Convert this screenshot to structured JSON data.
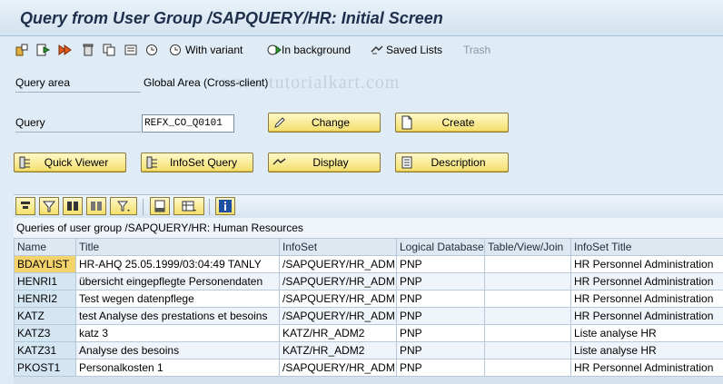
{
  "window": {
    "title": "Query from User Group /SAPQUERY/HR: Initial Screen"
  },
  "toolbar": {
    "with_variant": "With variant",
    "in_background": "In background",
    "saved_lists": "Saved Lists",
    "trash": "Trash",
    "watermark": "www.tutorialkart.com"
  },
  "form": {
    "query_area_label": "Query area",
    "query_area_value": "Global Area (Cross-client)",
    "query_label": "Query",
    "query_value": "REFX_CO_Q0101",
    "change": "Change",
    "create": "Create",
    "quick_viewer": "Quick Viewer",
    "infoset_query": "InfoSet Query",
    "display": "Display",
    "description": "Description"
  },
  "grid": {
    "caption": "Queries of user group /SAPQUERY/HR: Human Resources",
    "columns": [
      "Name",
      "Title",
      "InfoSet",
      "Logical Database",
      "Table/View/Join",
      "InfoSet Title"
    ],
    "rows": [
      [
        "BDAYLIST",
        "HR-AHQ 25.05.1999/03:04:49 TANLY",
        "/SAPQUERY/HR_ADM",
        "PNP",
        "",
        "HR Personnel Administration"
      ],
      [
        "HENRI1",
        "übersicht eingepflegte Personendaten",
        "/SAPQUERY/HR_ADM",
        "PNP",
        "",
        "HR Personnel Administration"
      ],
      [
        "HENRI2",
        "Test wegen datenpflege",
        "/SAPQUERY/HR_ADM",
        "PNP",
        "",
        "HR Personnel Administration"
      ],
      [
        "KATZ",
        "test Analyse des prestations et besoins",
        "/SAPQUERY/HR_ADM",
        "PNP",
        "",
        "HR Personnel Administration"
      ],
      [
        "KATZ3",
        "katz 3",
        "KATZ/HR_ADM2",
        "PNP",
        "",
        "Liste analyse HR"
      ],
      [
        "KATZ31",
        "Analyse des besoins",
        "KATZ/HR_ADM2",
        "PNP",
        "",
        "Liste analyse HR"
      ],
      [
        "PKOST1",
        "Personalkosten 1",
        "/SAPQUERY/HR_ADM",
        "PNP",
        "",
        "HR Personnel Administration"
      ]
    ]
  }
}
